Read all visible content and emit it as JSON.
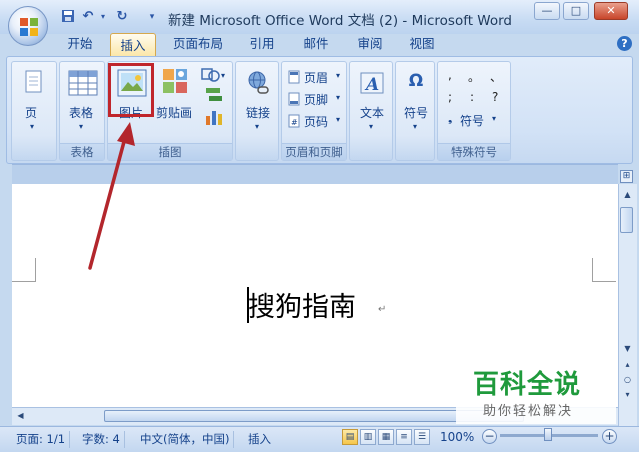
{
  "window": {
    "title": "新建 Microsoft Office Word 文档 (2) - Microsoft Word",
    "minimize_label": "—",
    "maximize_label": "□",
    "close_label": "✕"
  },
  "quick_access": {
    "icons": [
      "save-icon",
      "undo-icon",
      "redo-icon",
      "customize-icon"
    ]
  },
  "tabs": [
    "开始",
    "插入",
    "页面布局",
    "引用",
    "邮件",
    "审阅",
    "视图"
  ],
  "active_tab": "插入",
  "help_label": "?",
  "ribbon": {
    "page_label": "页",
    "table_label": "表格",
    "table_group": "表格",
    "picture_label": "图片",
    "clipart_label": "剪贴画",
    "illustrations_group": "插图",
    "link_label": "链接",
    "header_label": "页眉",
    "footer_label": "页脚",
    "page_number_label": "页码",
    "header_footer_group": "页眉和页脚",
    "text_label": "文本",
    "symbol_label": "符号",
    "symbol_glyph": "Ω",
    "special_symbols": [
      ",",
      "。",
      "、",
      ";",
      ":",
      "?"
    ],
    "special_symbol_button": "符号",
    "special_symbols_group": "特殊符号"
  },
  "document": {
    "text": "搜狗指南",
    "paragraph_mark": "↵"
  },
  "status": {
    "page": "页面: 1/1",
    "word_count": "字数: 4",
    "language": "中文(简体，中国)",
    "mode": "插入",
    "zoom": "100%",
    "zoom_minus": "−",
    "zoom_plus": "+"
  },
  "watermark": {
    "title": "百科全说",
    "subtitle": "助你轻松解决"
  },
  "colors": {
    "highlight": "#c0262c",
    "arrow": "#b3262c",
    "watermark_green": "#1f9a3c"
  }
}
